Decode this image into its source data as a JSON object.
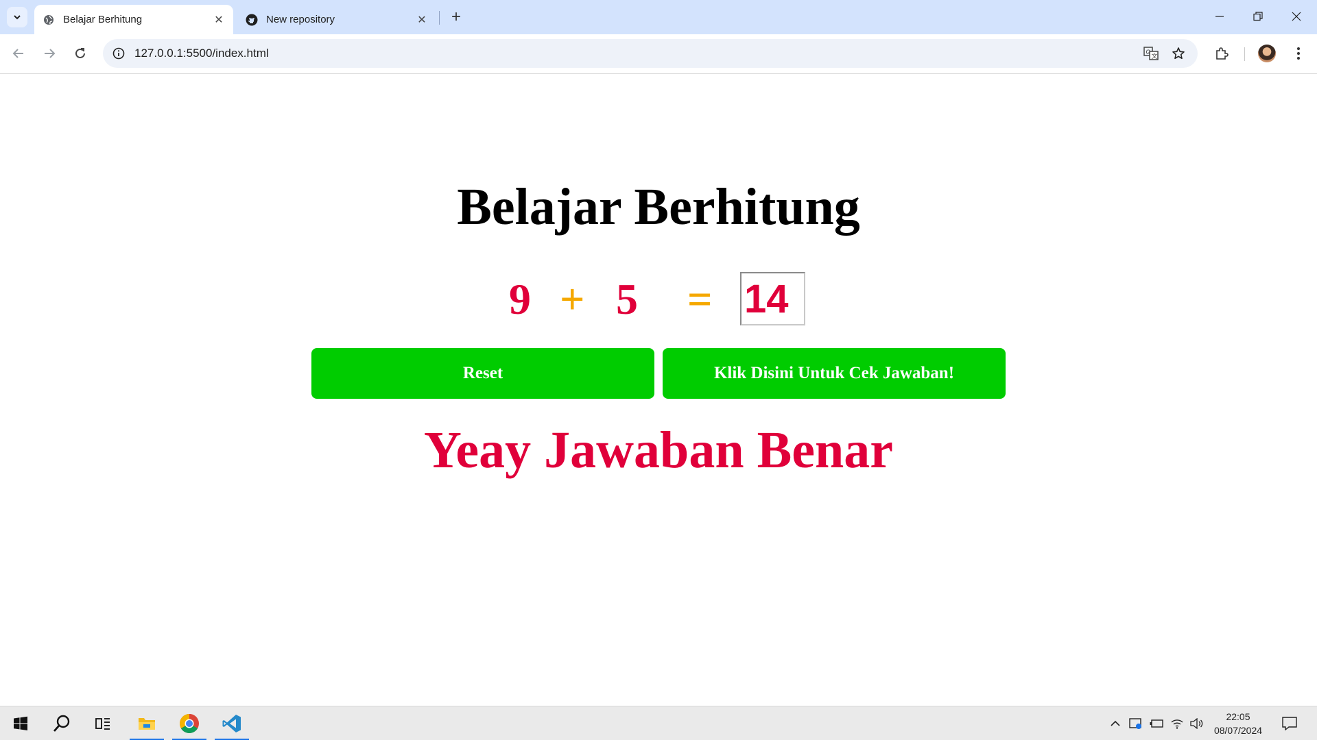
{
  "browser": {
    "tabs": [
      {
        "title": "Belajar Berhitung",
        "active": true
      },
      {
        "title": "New repository",
        "active": false
      }
    ],
    "url": "127.0.0.1:5500/index.html"
  },
  "page": {
    "title": "Belajar Berhitung",
    "equation": {
      "first_number": "9",
      "operator": "+",
      "second_number": "5",
      "equals": "=",
      "answer_value": "14"
    },
    "buttons": {
      "reset_label": "Reset",
      "check_label": "Klik Disini Untuk Cek Jawaban!"
    },
    "result_message": "Yeay Jawaban Benar"
  },
  "colors": {
    "number": "#e0003a",
    "operator": "#f5a800",
    "button": "#00cc00",
    "tabstrip": "#d3e3fd"
  },
  "taskbar": {
    "apps": [
      "start-icon",
      "search-icon",
      "task-view-icon",
      "file-explorer-icon",
      "chrome-icon",
      "vscode-icon"
    ],
    "time": "22:05",
    "date": "08/07/2024"
  }
}
